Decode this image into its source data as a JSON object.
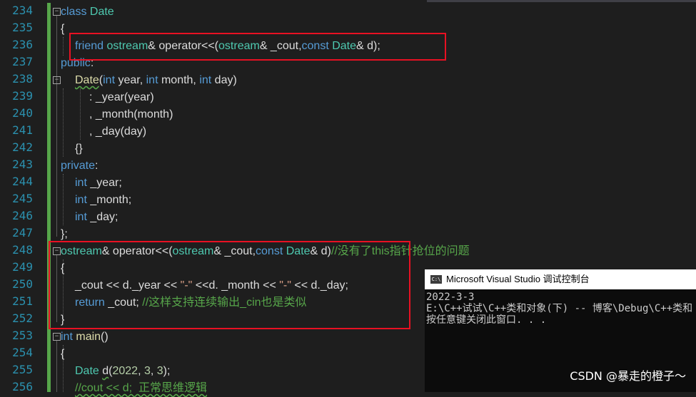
{
  "editor": {
    "line_numbers": [
      "234",
      "235",
      "236",
      "237",
      "238",
      "239",
      "240",
      "241",
      "242",
      "243",
      "244",
      "245",
      "246",
      "247",
      "248",
      "249",
      "250",
      "251",
      "252",
      "253",
      "254",
      "255",
      "256"
    ],
    "code": {
      "l234": {
        "kw": "class",
        "name": "Date"
      },
      "l235": {
        "t": "{"
      },
      "l236": {
        "kw": "friend",
        "ty": "ostream",
        "a": "& operator<<(",
        "ty2": "ostream",
        "b": "& _cout,",
        "kw2": "const",
        "ty3": "Date",
        "c": "& d);"
      },
      "l237": {
        "kw": "public",
        ":": ":"
      },
      "l238": {
        "fn": "Date",
        "a": "(",
        "kw1": "int",
        "b": " year, ",
        "kw2": "int",
        "c": " month, ",
        "kw3": "int",
        "d": " day)"
      },
      "l239": {
        "a": ": _year",
        "b": "(year)"
      },
      "l240": {
        "a": ", _month",
        "b": "(month)"
      },
      "l241": {
        "a": ", _day",
        "b": "(day)"
      },
      "l242": {
        "t": "{}"
      },
      "l243": {
        "kw": "private",
        ":": ":"
      },
      "l244": {
        "kw": "int",
        "t": " _year;"
      },
      "l245": {
        "kw": "int",
        "t": " _month;"
      },
      "l246": {
        "kw": "int",
        "t": " _day;"
      },
      "l247": {
        "t": "};"
      },
      "l248": {
        "ty": "ostream",
        "a": "& operator<<(",
        "ty2": "ostream",
        "b": "& _cout,",
        "kw": "const",
        "ty3": "Date",
        "c": "& d)",
        "cm": "//没有了this指针抢位的问题"
      },
      "l249": {
        "t": "{"
      },
      "l250": {
        "a": "_cout << d._year << ",
        "s1": "\"-\"",
        "b": " <<d. _month << ",
        "s2": "\"-\"",
        "c": " << d._day;"
      },
      "l251": {
        "kw": "return",
        "a": " _cout; ",
        "cm": "//这样支持连续输出_cin也是类似"
      },
      "l252": {
        "t": "}"
      },
      "l253": {
        "kw": "int",
        "a": " ",
        "fn": "main",
        "b": "()"
      },
      "l254": {
        "t": "{"
      },
      "l255": {
        "ty": "Date",
        "a": " ",
        "fn": "d",
        "b": "(",
        "n1": "2022",
        "c": ", ",
        "n2": "3",
        "d": ", ",
        "n3": "3",
        "e": ");"
      },
      "l256": {
        "cm": "//cout << d;  正常思维逻辑"
      }
    }
  },
  "console": {
    "icon_text": "C:\\",
    "title": "Microsoft Visual Studio 调试控制台",
    "lines": [
      "2022-3-3",
      "E:\\C++试试\\C++类和对象(下) -- 博客\\Debug\\C++类和",
      "按任意键关闭此窗口. . ."
    ]
  },
  "watermark": "CSDN @暴走的橙子～",
  "colors": {
    "keyword": "#569cd6",
    "type": "#4ec9b0",
    "function": "#dcdcaa",
    "string": "#d69d85",
    "number": "#b5cea8",
    "comment": "#57a64a",
    "highlight": "#e81123"
  }
}
